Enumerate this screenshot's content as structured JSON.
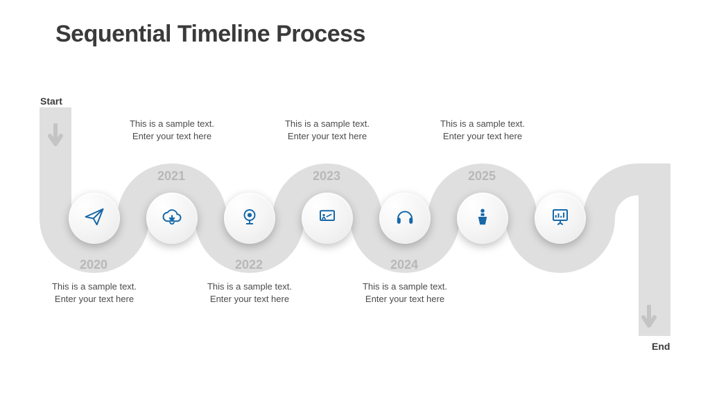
{
  "title": "Sequential Timeline Process",
  "startLabel": "Start",
  "endLabel": "End",
  "colors": {
    "path": "#dfdfdf",
    "icon": "#1768a8",
    "text": "#4a4a4a",
    "yearText": "#b8b8b8"
  },
  "items": [
    {
      "year": "2020",
      "icon": "paper-plane",
      "desc": "This is a sample text. Enter your text here",
      "position": "bottom"
    },
    {
      "year": "2021",
      "icon": "cloud-download",
      "desc": "This is a sample text. Enter your text here",
      "position": "top"
    },
    {
      "year": "2022",
      "icon": "webcam",
      "desc": "This is a sample text. Enter your text here",
      "position": "bottom"
    },
    {
      "year": "2023",
      "icon": "presentation",
      "desc": "This is a sample text. Enter your text here",
      "position": "top"
    },
    {
      "year": "2024",
      "icon": "headphones",
      "desc": "This is a sample text. Enter your text here",
      "position": "bottom"
    },
    {
      "year": "2025",
      "icon": "podium",
      "desc": "This is a sample text. Enter your text here",
      "position": "top"
    }
  ]
}
